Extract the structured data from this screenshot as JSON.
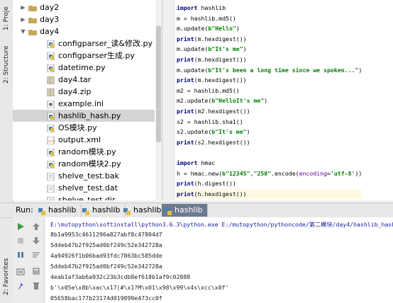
{
  "side_tabs": {
    "project": "1: Proje",
    "structure": "2: Structure",
    "favorites": "2: Favorites"
  },
  "tree": {
    "items": [
      {
        "label": "day2",
        "kind": "folder",
        "expanded": false
      },
      {
        "label": "day3",
        "kind": "folder",
        "expanded": false
      },
      {
        "label": "day4",
        "kind": "folder",
        "expanded": true
      },
      {
        "label": "configparser_读&修改.py",
        "kind": "py"
      },
      {
        "label": "configparser生成.py",
        "kind": "py"
      },
      {
        "label": "datetime.py",
        "kind": "py"
      },
      {
        "label": "day4.tar",
        "kind": "archive"
      },
      {
        "label": "day4.zip",
        "kind": "zip"
      },
      {
        "label": "example.ini",
        "kind": "ini"
      },
      {
        "label": "hashlib_hash.py",
        "kind": "py",
        "selected": true
      },
      {
        "label": "OS模块.py",
        "kind": "py"
      },
      {
        "label": "output.xml",
        "kind": "xml"
      },
      {
        "label": "random模块.py",
        "kind": "py"
      },
      {
        "label": "random模块2.py",
        "kind": "py"
      },
      {
        "label": "shelve_test.bak",
        "kind": "file"
      },
      {
        "label": "shelve_test.dat",
        "kind": "file"
      },
      {
        "label": "shelve_test.dir",
        "kind": "file"
      }
    ]
  },
  "editor": {
    "lines": [
      {
        "t": "import hashlib"
      },
      {
        "t": "m = hashlib.md5()"
      },
      {
        "t": "m.update(b\"Hello\")"
      },
      {
        "t": "print(m.hexdigest())"
      },
      {
        "t": "m.update(b\"It's me\")"
      },
      {
        "t": "print(m.hexdigest())"
      },
      {
        "t": "m.update(b\"It's been a long time since we spoken...\")"
      },
      {
        "t": "print(m.hexdigest())"
      },
      {
        "t": "m2 = hashlib.md5()"
      },
      {
        "t": "m2.update(b\"HelloIt's me\")"
      },
      {
        "t": "print(m2.hexdigest())"
      },
      {
        "t": "s2 = hashlib.sha1()"
      },
      {
        "t": "s2.update(b\"It's me\")"
      },
      {
        "t": "print(s2.hexdigest())"
      },
      {
        "t": ""
      },
      {
        "t": "import hmac"
      },
      {
        "t": "h = hmac.new(b\"12345\",\"250\".encode(encoding='utf-8'))"
      },
      {
        "t": "print(h.digest())"
      },
      {
        "t": "print(h.hexdigest())"
      }
    ]
  },
  "run": {
    "label": "Run:",
    "tabs": [
      "hashlib",
      "hashlib",
      "hashlib",
      "hashlib"
    ],
    "active_tab": 3
  },
  "console": {
    "lines": [
      "E:\\mutopython\\softinstall\\python3.6.3\\python.exe E:/mutopython/pythoncode/第二模块/day4/hashlib_hash.py",
      "8b1a9953c4611296a827abf8c47804d7",
      "5ddeb47b2f925ad0bf249c52e342728a",
      "4a94926f1b06bad93fdc7863bc585dde",
      "5ddeb47b2f925ad0bf249c52e342728a",
      "4eab1af3ab6a932c23b3cdb8ef618b1af9c02088",
      "b'\\x05e\\x8b\\xac\\x17(#\\x1?M\\x01\\x98\\x99\\x4s\\xcc\\x0f'",
      "05658bac177b23174d019899e473cc0f"
    ]
  },
  "colors": {
    "selection": "#d5d5d5",
    "active_tab": "#6c7b8f",
    "keyword": "#000080",
    "string": "#008000",
    "number": "#0000ff"
  }
}
